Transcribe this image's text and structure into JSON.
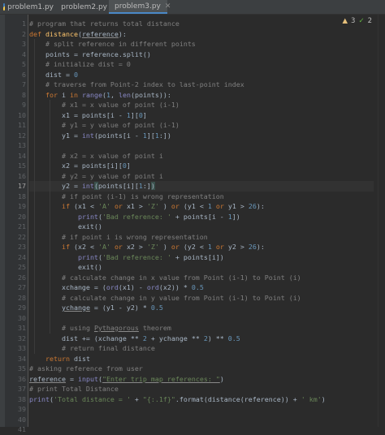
{
  "tabs": [
    {
      "label": "problem1.py",
      "active": false
    },
    {
      "label": "problem2.py",
      "active": false
    },
    {
      "label": "problem3.py",
      "active": true
    }
  ],
  "inspection": {
    "warnings": "3",
    "weak_warnings": "2"
  },
  "current_line": 17,
  "lines": [
    [
      [
        "cm",
        "# program that returns total distance"
      ]
    ],
    [
      [
        "kw",
        "def "
      ],
      [
        "fn",
        "distance"
      ],
      [
        "",
        "("
      ],
      [
        "ul",
        "reference"
      ],
      [
        "",
        "):"
      ]
    ],
    [
      [
        "",
        "    "
      ],
      [
        "cm",
        "# split reference in different points"
      ]
    ],
    [
      [
        "",
        "    points = reference.split()"
      ]
    ],
    [
      [
        "",
        "    "
      ],
      [
        "cm",
        "# initialize dist = 0"
      ]
    ],
    [
      [
        "",
        "    dist = "
      ],
      [
        "nm",
        "0"
      ]
    ],
    [
      [
        "",
        "    "
      ],
      [
        "cm",
        "# traverse from Point-2 index to last-point index"
      ]
    ],
    [
      [
        "",
        "    "
      ],
      [
        "kw",
        "for "
      ],
      [
        "",
        "i "
      ],
      [
        "kw",
        "in "
      ],
      [
        "bi",
        "range"
      ],
      [
        "",
        "("
      ],
      [
        "nm",
        "1"
      ],
      [
        "",
        ", "
      ],
      [
        "bi",
        "len"
      ],
      [
        "",
        "(points)):"
      ]
    ],
    [
      [
        "",
        "        "
      ],
      [
        "cm",
        "# x1 = x value of point (i-1)"
      ]
    ],
    [
      [
        "",
        "        x1 = points[i - "
      ],
      [
        "nm",
        "1"
      ],
      [
        "",
        "]["
      ],
      [
        "nm",
        "0"
      ],
      [
        "",
        "]"
      ]
    ],
    [
      [
        "",
        "        "
      ],
      [
        "cm",
        "# y1 = y value of point (i-1)"
      ]
    ],
    [
      [
        "",
        "        y1 = "
      ],
      [
        "bi",
        "int"
      ],
      [
        "",
        "(points[i - "
      ],
      [
        "nm",
        "1"
      ],
      [
        "",
        "]["
      ],
      [
        "nm",
        "1"
      ],
      [
        "",
        ":])"
      ]
    ],
    [
      [
        "",
        ""
      ]
    ],
    [
      [
        "",
        "        "
      ],
      [
        "cm",
        "# x2 = x value of point i"
      ]
    ],
    [
      [
        "",
        "        x2 = points[i]["
      ],
      [
        "nm",
        "0"
      ],
      [
        "",
        "]"
      ]
    ],
    [
      [
        "",
        "        "
      ],
      [
        "cm",
        "# y2 = y value of point i"
      ]
    ],
    [
      [
        "",
        "        y2 = "
      ],
      [
        "bi",
        "int"
      ],
      [
        "hl",
        "("
      ],
      [
        "",
        "points[i]["
      ],
      [
        "nm",
        "1"
      ],
      [
        "",
        ":]"
      ],
      [
        "hl",
        ")"
      ]
    ],
    [
      [
        "",
        "        "
      ],
      [
        "cm",
        "# if point (i-1) is wrong representation"
      ]
    ],
    [
      [
        "",
        "        "
      ],
      [
        "kw",
        "if "
      ],
      [
        "",
        "(x1 < "
      ],
      [
        "st",
        "'A' "
      ],
      [
        "kw",
        "or "
      ],
      [
        "",
        "x1 > "
      ],
      [
        "st",
        "'Z'"
      ],
      [
        "",
        " ) "
      ],
      [
        "kw",
        "or "
      ],
      [
        "",
        "(y1 < "
      ],
      [
        "nm",
        "1 "
      ],
      [
        "kw",
        "or "
      ],
      [
        "",
        "y1 > "
      ],
      [
        "nm",
        "26"
      ],
      [
        "",
        "):"
      ]
    ],
    [
      [
        "",
        "            "
      ],
      [
        "bi",
        "print"
      ],
      [
        "",
        "("
      ],
      [
        "st",
        "'Bad reference: ' "
      ],
      [
        "",
        "+ points[i - "
      ],
      [
        "nm",
        "1"
      ],
      [
        "",
        "])"
      ]
    ],
    [
      [
        "",
        "            exit()"
      ]
    ],
    [
      [
        "",
        "        "
      ],
      [
        "cm",
        "# if point i is wrong representation"
      ]
    ],
    [
      [
        "",
        "        "
      ],
      [
        "kw",
        "if "
      ],
      [
        "",
        "(x2 < "
      ],
      [
        "st",
        "'A' "
      ],
      [
        "kw",
        "or "
      ],
      [
        "",
        "x2 > "
      ],
      [
        "st",
        "'Z'"
      ],
      [
        "",
        " ) "
      ],
      [
        "kw",
        "or "
      ],
      [
        "",
        "(y2 < "
      ],
      [
        "nm",
        "1 "
      ],
      [
        "kw",
        "or "
      ],
      [
        "",
        "y2 > "
      ],
      [
        "nm",
        "26"
      ],
      [
        "",
        "):"
      ]
    ],
    [
      [
        "",
        "            "
      ],
      [
        "bi",
        "print"
      ],
      [
        "",
        "("
      ],
      [
        "st",
        "'Bad reference: ' "
      ],
      [
        "",
        "+ points[i])"
      ]
    ],
    [
      [
        "",
        "            exit()"
      ]
    ],
    [
      [
        "",
        "        "
      ],
      [
        "cm",
        "# calculate change in x value from Point (i-1) to Point (i)"
      ]
    ],
    [
      [
        "",
        "        xchange = ("
      ],
      [
        "bi",
        "ord"
      ],
      [
        "",
        "(x1) - "
      ],
      [
        "bi",
        "ord"
      ],
      [
        "",
        "(x2)) * "
      ],
      [
        "nm",
        "0.5"
      ]
    ],
    [
      [
        "",
        "        "
      ],
      [
        "cm",
        "# calculate change in y value from Point (i-1) to Point (i)"
      ]
    ],
    [
      [
        "",
        "        "
      ],
      [
        "ul",
        "ychange"
      ],
      [
        "",
        " = (y1 - y2) * "
      ],
      [
        "nm",
        "0.5"
      ]
    ],
    [
      [
        "",
        ""
      ]
    ],
    [
      [
        "",
        "        "
      ],
      [
        "cm",
        "# using "
      ],
      [
        "cm ul",
        "Pythagorous"
      ],
      [
        "cm",
        " theorem"
      ]
    ],
    [
      [
        "",
        "        dist += (xchange ** "
      ],
      [
        "nm",
        "2 "
      ],
      [
        "",
        "+ ychange ** "
      ],
      [
        "nm",
        "2"
      ],
      [
        "",
        ") ** "
      ],
      [
        "nm",
        "0.5"
      ]
    ],
    [
      [
        "",
        "        "
      ],
      [
        "cm",
        "# return final distance"
      ]
    ],
    [
      [
        "",
        "    "
      ],
      [
        "kw",
        "return "
      ],
      [
        "",
        "dist"
      ]
    ],
    [
      [
        "cm",
        "# asking reference from user"
      ]
    ],
    [
      [
        "ul",
        "reference"
      ],
      [
        "",
        " = "
      ],
      [
        "bi",
        "input"
      ],
      [
        "",
        "("
      ],
      [
        "st ul",
        "\"Enter trip map references: \""
      ],
      [
        "",
        ")"
      ]
    ],
    [
      [
        "cm",
        "# print Total Distance"
      ]
    ],
    [
      [
        "bi",
        "print"
      ],
      [
        "",
        "("
      ],
      [
        "st",
        "'Total distance = ' "
      ],
      [
        "",
        "+ "
      ],
      [
        "st",
        "\"{:.1f}\""
      ],
      [
        "",
        ".format(distance(reference)) + "
      ],
      [
        "st",
        "' km'"
      ],
      [
        "",
        ")"
      ]
    ],
    [
      [
        "",
        ""
      ]
    ],
    [
      [
        "",
        ""
      ]
    ],
    [
      [
        "",
        ""
      ]
    ]
  ]
}
